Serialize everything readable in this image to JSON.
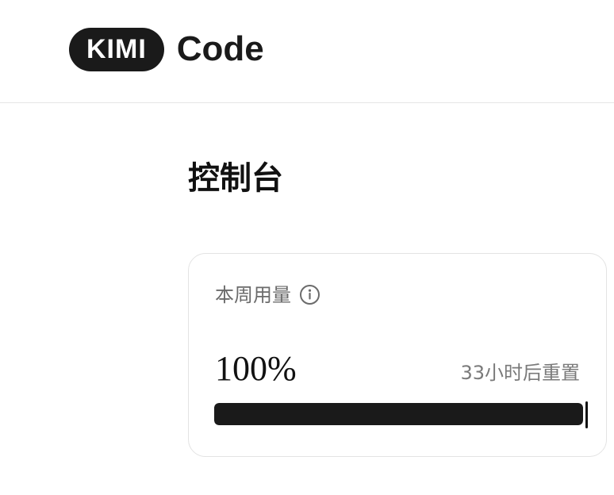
{
  "header": {
    "logo_pill": "KIMI",
    "logo_text": "Code"
  },
  "main": {
    "page_title": "控制台",
    "usage_card": {
      "title": "本周用量",
      "info_icon": "info-circle-icon",
      "percent_label": "100%",
      "percent_value": 1.0,
      "reset_text": "33小时后重置"
    }
  },
  "colors": {
    "primary": "#1a1a1a",
    "muted_text": "#6b6b6b",
    "border": "#e3e3e3"
  }
}
